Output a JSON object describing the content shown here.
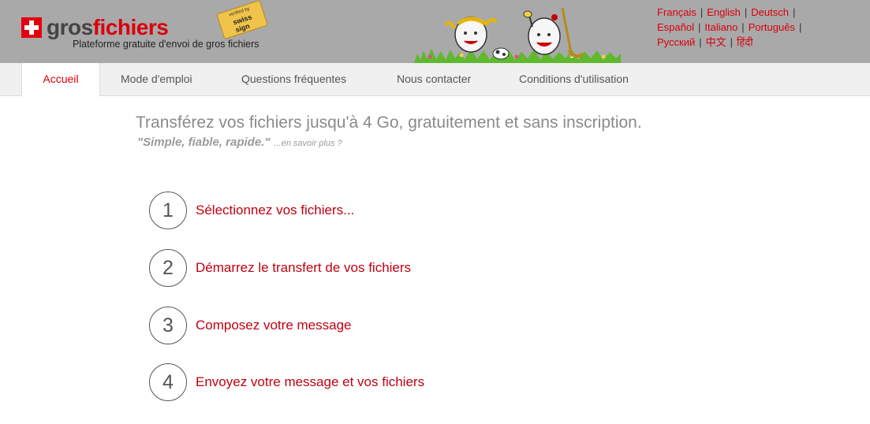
{
  "brand": {
    "name_part1": "gros",
    "name_part2": "fichiers",
    "tagline": "Plateforme gratuite d'envoi de gros fichiers",
    "badge_line1": "verified by",
    "badge_line2": "swiss sign",
    "accent_color": "#d8000c"
  },
  "languages": [
    [
      "Français",
      "English",
      "Deutsch"
    ],
    [
      "Español",
      "Italiano",
      "Português"
    ],
    [
      "Русский",
      "中文",
      "हिंदी"
    ]
  ],
  "lang": {
    "fr": "Français",
    "en": "English",
    "de": "Deutsch",
    "es": "Español",
    "it": "Italiano",
    "pt": "Português",
    "ru": "Русский",
    "zh": "中文",
    "hi": "हिंदी",
    "sep": "|"
  },
  "nav": {
    "home": "Accueil",
    "guide": "Mode d'emploi",
    "faq": "Questions fréquentes",
    "contact": "Nous contacter",
    "terms": "Conditions d'utilisation"
  },
  "main": {
    "headline": "Transférez vos fichiers jusqu'à 4 Go, gratuitement et sans inscription.",
    "slogan": "\"Simple, fiable, rapide.\"",
    "learn_more": "...en savoir plus ?"
  },
  "steps": [
    {
      "number": "1",
      "label": "Sélectionnez vos fichiers..."
    },
    {
      "number": "2",
      "label": "Démarrez le transfert de vos fichiers"
    },
    {
      "number": "3",
      "label": "Composez votre message"
    },
    {
      "number": "4",
      "label": "Envoyez votre message et vos fichiers"
    }
  ]
}
